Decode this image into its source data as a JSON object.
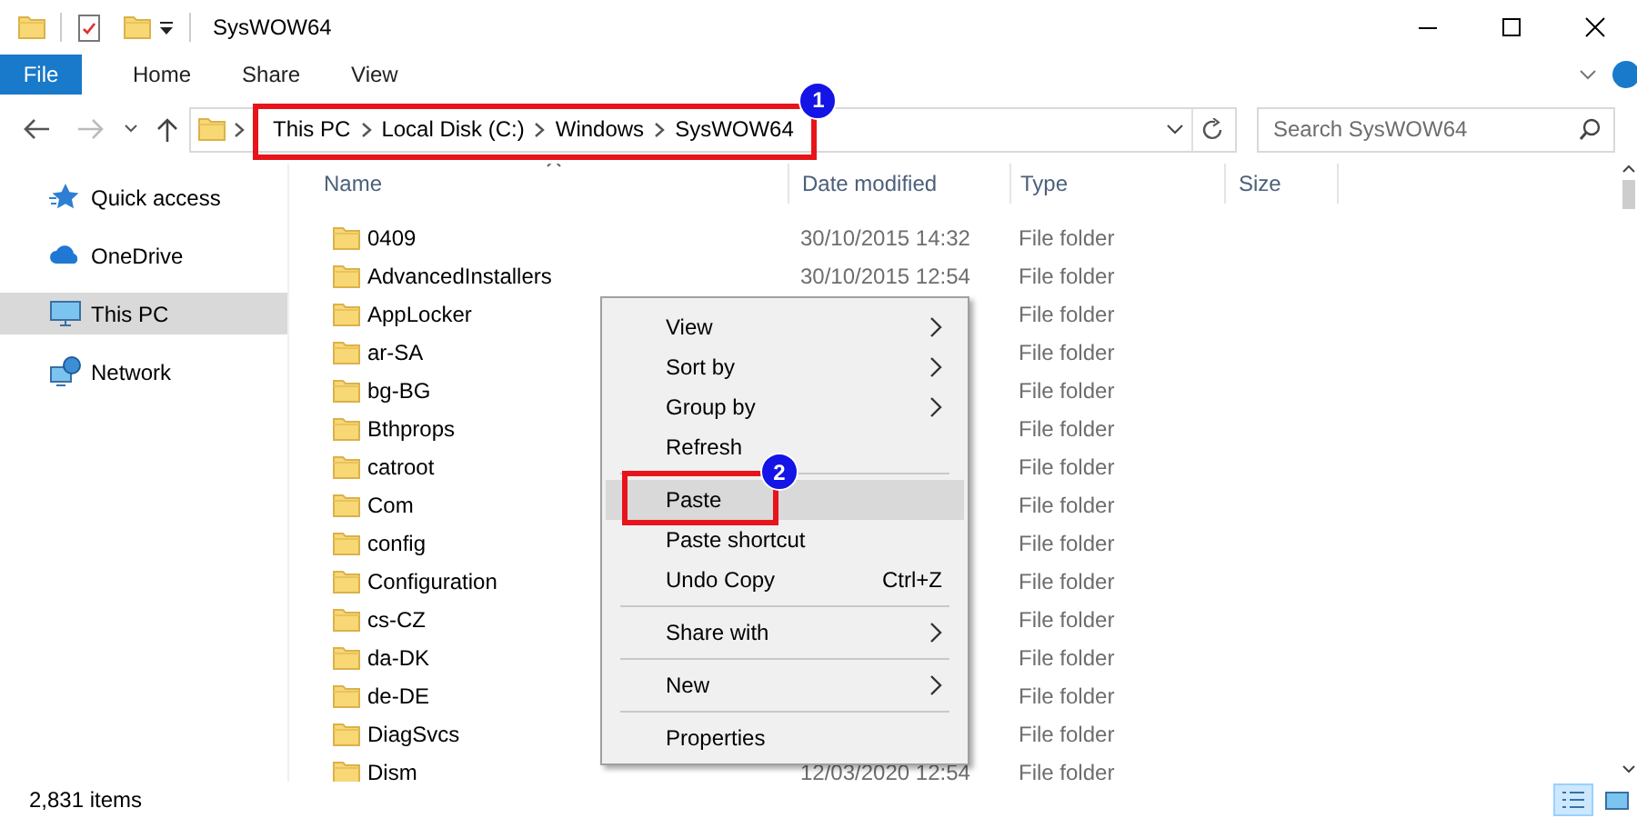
{
  "window": {
    "title": "SysWOW64"
  },
  "ribbon": {
    "tabs": [
      {
        "label": "File",
        "kind": "file"
      },
      {
        "label": "Home",
        "kind": "tab"
      },
      {
        "label": "Share",
        "kind": "tab"
      },
      {
        "label": "View",
        "kind": "tab"
      }
    ]
  },
  "address_bar": {
    "breadcrumbs": [
      "This PC",
      "Local Disk (C:)",
      "Windows",
      "SysWOW64"
    ],
    "annotation": "1"
  },
  "search": {
    "placeholder": "Search SysWOW64"
  },
  "sidebar": {
    "items": [
      {
        "label": "Quick access",
        "kind": "star",
        "selected": false
      },
      {
        "label": "OneDrive",
        "kind": "cloud",
        "selected": false
      },
      {
        "label": "This PC",
        "kind": "computer",
        "selected": true
      },
      {
        "label": "Network",
        "kind": "network",
        "selected": false
      }
    ]
  },
  "file_list": {
    "columns": [
      {
        "label": "Name",
        "sorted": true
      },
      {
        "label": "Date modified",
        "sorted": false
      },
      {
        "label": "Type",
        "sorted": false
      },
      {
        "label": "Size",
        "sorted": false
      }
    ],
    "rows": [
      {
        "name": "0409",
        "date_modified": "30/10/2015 14:32",
        "type": "File folder"
      },
      {
        "name": "AdvancedInstallers",
        "date_modified": "30/10/2015 12:54",
        "type": "File folder"
      },
      {
        "name": "AppLocker",
        "type": "File folder"
      },
      {
        "name": "ar-SA",
        "type": "File folder"
      },
      {
        "name": "bg-BG",
        "type": "File folder"
      },
      {
        "name": "Bthprops",
        "type": "File folder"
      },
      {
        "name": "catroot",
        "type": "File folder"
      },
      {
        "name": "Com",
        "type": "File folder"
      },
      {
        "name": "config",
        "type": "File folder"
      },
      {
        "name": "Configuration",
        "type": "File folder"
      },
      {
        "name": "cs-CZ",
        "type": "File folder"
      },
      {
        "name": "da-DK",
        "type": "File folder"
      },
      {
        "name": "de-DE",
        "type": "File folder"
      },
      {
        "name": "DiagSvcs",
        "type": "File folder"
      },
      {
        "name": "Dism",
        "date_modified": "12/03/2020 12:54",
        "type": "File folder"
      }
    ]
  },
  "context_menu": {
    "items": [
      {
        "kind": "item",
        "label": "View",
        "submenu": true,
        "selected": false
      },
      {
        "kind": "item",
        "label": "Sort by",
        "submenu": true,
        "selected": false
      },
      {
        "kind": "item",
        "label": "Group by",
        "submenu": true,
        "selected": false
      },
      {
        "kind": "item",
        "label": "Refresh",
        "submenu": false,
        "selected": false
      },
      {
        "kind": "separator"
      },
      {
        "kind": "item",
        "label": "Paste",
        "submenu": false,
        "selected": true,
        "annotation": "2"
      },
      {
        "kind": "item",
        "label": "Paste shortcut",
        "submenu": false,
        "selected": false
      },
      {
        "kind": "item",
        "label": "Undo Copy",
        "shortcut": "Ctrl+Z",
        "submenu": false,
        "selected": false
      },
      {
        "kind": "separator"
      },
      {
        "kind": "item",
        "label": "Share with",
        "submenu": true,
        "selected": false
      },
      {
        "kind": "separator"
      },
      {
        "kind": "item",
        "label": "New",
        "submenu": true,
        "selected": false
      },
      {
        "kind": "separator"
      },
      {
        "kind": "item",
        "label": "Properties",
        "submenu": false,
        "selected": false
      }
    ]
  },
  "status_bar": {
    "item_count": "2,831 items",
    "view_buttons": [
      {
        "kind": "details",
        "selected": true
      },
      {
        "kind": "tiles",
        "selected": false
      }
    ]
  }
}
